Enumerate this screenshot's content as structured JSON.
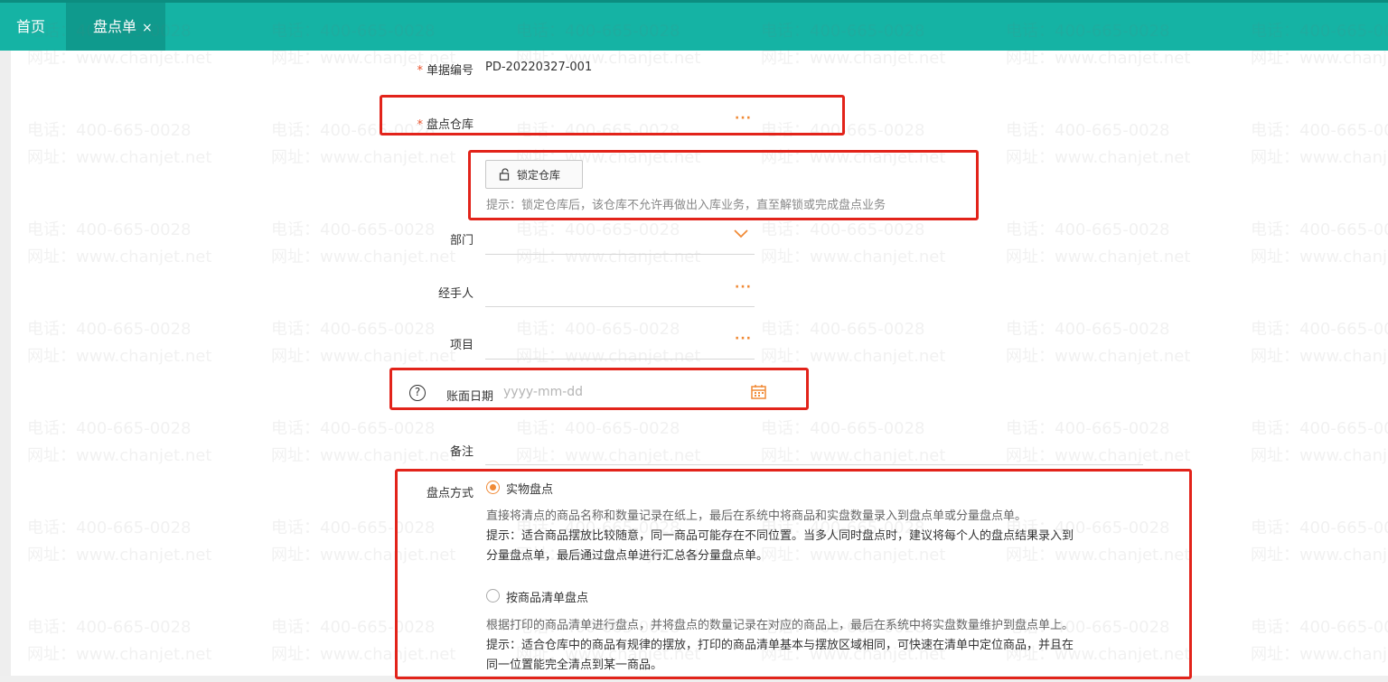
{
  "tabs": {
    "home_label": "首页",
    "active_label": "盘点单",
    "close_glyph": "×"
  },
  "watermark": {
    "phone": "电话：400-665-0028",
    "site": "网址：www.chanjet.net"
  },
  "form": {
    "doc_no": {
      "required": "*",
      "label": "单据编号",
      "value": "PD-20220327-001"
    },
    "warehouse": {
      "required": "*",
      "label": "盘点仓库",
      "picker_icon": "ellipsis-icon"
    },
    "lock": {
      "button_label": "锁定仓库",
      "icon": "lock-open-icon",
      "hint": "提示：锁定仓库后，该仓库不允许再做出入库业务，直至解锁或完成盘点业务"
    },
    "department": {
      "label": "部门",
      "icon": "chevron-down-icon"
    },
    "handler": {
      "label": "经手人"
    },
    "project": {
      "label": "项目"
    },
    "book_date": {
      "help": "?",
      "label": "账面日期",
      "placeholder": "yyyy-mm-dd",
      "icon": "calendar-icon"
    },
    "remark": {
      "label": "备注"
    },
    "method": {
      "label": "盘点方式",
      "options": [
        {
          "label": "实物盘点",
          "selected": true,
          "lines": [
            "直接将清点的商品名称和数量记录在纸上，最后在系统中将商品和实盘数量录入到盘点单或分量盘点单。",
            "提示：适合商品摆放比较随意，同一商品可能存在不同位置。当多人同时盘点时，建议将每个人的盘点结果录入到",
            "分量盘点单，最后通过盘点单进行汇总各分量盘点单。"
          ]
        },
        {
          "label": "按商品清单盘点",
          "selected": false,
          "lines": [
            "根据打印的商品清单进行盘点，并将盘点的数量记录在对应的商品上，最后在系统中将实盘数量维护到盘点单上。",
            "提示：适合仓库中的商品有规律的摆放，打印的商品清单基本与摆放区域相同，可快速在清单中定位商品，并且在",
            "同一位置能完全清点到某一商品。"
          ]
        }
      ]
    }
  },
  "colors": {
    "header_bg": "#15b3a4",
    "accent": "#f08a36",
    "highlight_box": "#e2231a"
  }
}
